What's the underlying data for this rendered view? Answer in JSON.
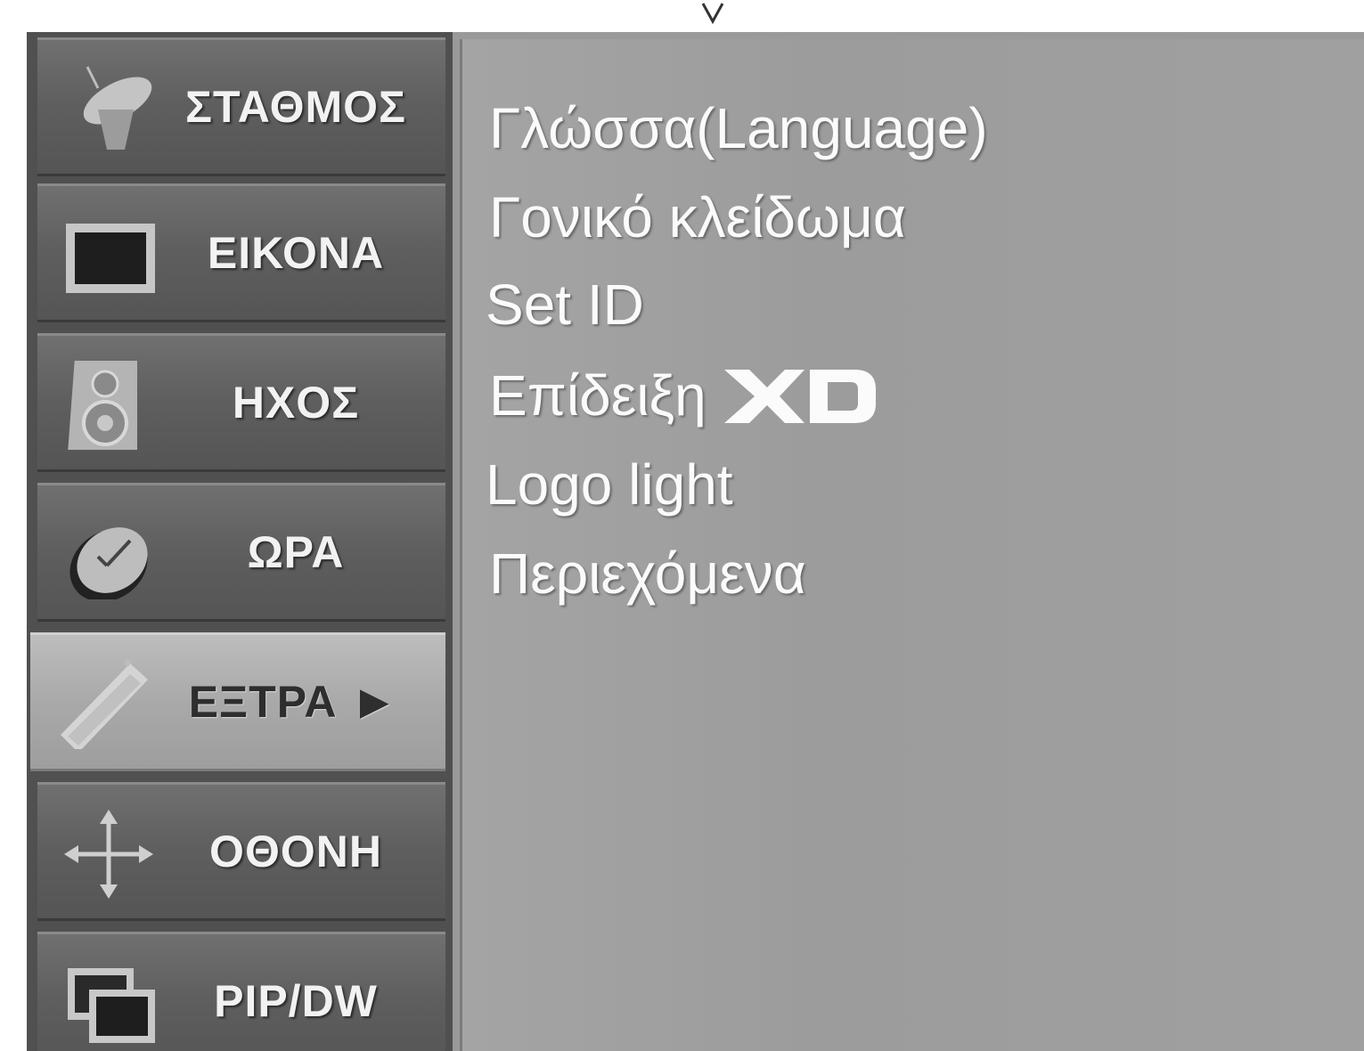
{
  "sidebar": {
    "items": [
      {
        "label": "ΣΤΑΘΜΟΣ",
        "icon": "satellite-dish-icon",
        "selected": false
      },
      {
        "label": "ΕΙΚΟΝΑ",
        "icon": "picture-icon",
        "selected": false
      },
      {
        "label": "ΗΧΟΣ",
        "icon": "speaker-icon",
        "selected": false
      },
      {
        "label": "ΩΡΑ",
        "icon": "clock-icon",
        "selected": false
      },
      {
        "label": "ΕΞΤΡΑ",
        "icon": "remote-control-icon",
        "selected": true,
        "arrow": "▶"
      },
      {
        "label": "ΟΘΟΝΗ",
        "icon": "screen-move-icon",
        "selected": false
      },
      {
        "label": "PIP/DW",
        "icon": "pip-icon",
        "selected": false
      }
    ]
  },
  "content": {
    "options": [
      {
        "label": "Γλώσσα(Language)"
      },
      {
        "label": "Γονικό κλείδωμα"
      },
      {
        "label": "Set ID"
      },
      {
        "label": "Επίδειξη",
        "logo": "XD"
      },
      {
        "label": "Logo light"
      },
      {
        "label": "Περιεχόμενα"
      }
    ]
  },
  "colors": {
    "menu_background": "#9a9a9a",
    "sidebar_background": "#505050",
    "selected_item": "#a9a9a9",
    "text": "#ffffff"
  }
}
